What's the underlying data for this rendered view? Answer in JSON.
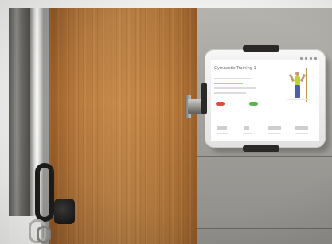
{
  "photo": {
    "subject": "wall-mounted-tablet",
    "colors": {
      "wood": "#c68a4b",
      "concrete": "#a3a29d",
      "tablet_frame": "#f7f7f6",
      "screen": "#ffffff",
      "button_red": "#e24b3b",
      "button_green": "#58b94a",
      "figure_top": "#b5d633",
      "figure_legs": "#4d5fa6"
    }
  },
  "tablet": {
    "screen_title": "Gymnastic Training 1"
  }
}
